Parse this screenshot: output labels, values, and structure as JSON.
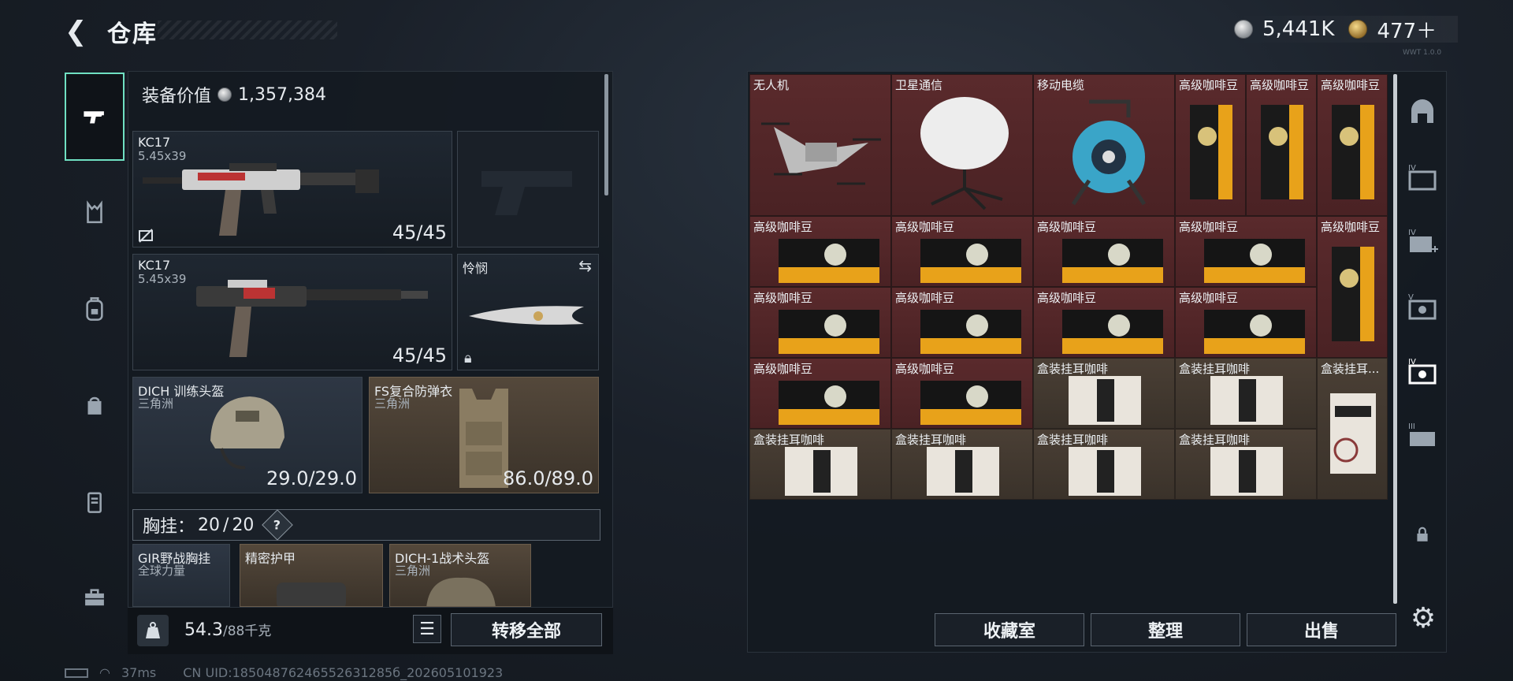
{
  "header": {
    "back_icon": "back-arrow-icon",
    "title": "仓库",
    "build_tag": "WWT 1.0.0"
  },
  "currencies": [
    {
      "icon": "silver-coin-icon",
      "value": "5,441K"
    },
    {
      "icon": "gold-coin-icon",
      "value": "477＋"
    }
  ],
  "left_tabs": [
    {
      "icon": "pistol-icon",
      "active": true
    },
    {
      "icon": "vest-icon",
      "active": false
    },
    {
      "icon": "backpack-icon",
      "active": false
    },
    {
      "icon": "pouch-icon",
      "active": false
    },
    {
      "icon": "case-icon",
      "active": false
    },
    {
      "icon": "toolbox-icon",
      "active": false
    }
  ],
  "loadout": {
    "equip_value_label": "装备价值",
    "equip_value": "1,357,384",
    "primary1": {
      "name": "KC17",
      "caliber": "5.45x39",
      "ammo": "45/45"
    },
    "primary2": {
      "name": "KC17",
      "caliber": "5.45x39",
      "ammo": "45/45"
    },
    "melee": {
      "name": "怜悯"
    },
    "helmet": {
      "name": "DICH 训练头盔",
      "origin": "三角洲",
      "durability": "29.0/29.0"
    },
    "armor": {
      "name": "FS复合防弹衣",
      "origin": "三角洲",
      "durability": "86.0/89.0"
    },
    "chest_rig": {
      "label": "胸挂：",
      "count": "20",
      "max": "20",
      "help": "?"
    },
    "stash_items": [
      {
        "name": "GIR野战胸挂",
        "origin": "全球力量"
      },
      {
        "name": "精密护甲",
        "origin": ""
      },
      {
        "name": "DICH-1战术头盔",
        "origin": "三角洲"
      }
    ],
    "weight": "54.3",
    "weight_max": "/88千克",
    "transfer_all": "转移全部"
  },
  "status": {
    "ping": "37ms",
    "uid": "CN UID:18504876246552631285б_202605101923"
  },
  "grid_items": {
    "drone": "无人机",
    "satellite": "卫星通信",
    "cable": "移动电缆",
    "coffee": "高级咖啡豆",
    "drip_coffee": "盒装挂耳咖啡",
    "drip_coffee_short": "盒装挂耳..."
  },
  "right_tabs": [
    {
      "icon": "shelter-icon"
    },
    {
      "icon": "container-iv-icon"
    },
    {
      "icon": "container-iv-add-icon"
    },
    {
      "icon": "container-v-icon"
    },
    {
      "icon": "container-iv-active-icon"
    },
    {
      "icon": "container-iii-icon"
    },
    {
      "icon": "lock-icon"
    }
  ],
  "actions": {
    "collection": "收藏室",
    "organize": "整理",
    "sell": "出售"
  },
  "colors": {
    "accent": "#6fe0c2",
    "cell_red": "#5a2a2c",
    "cell_brown": "#4a3f35"
  }
}
